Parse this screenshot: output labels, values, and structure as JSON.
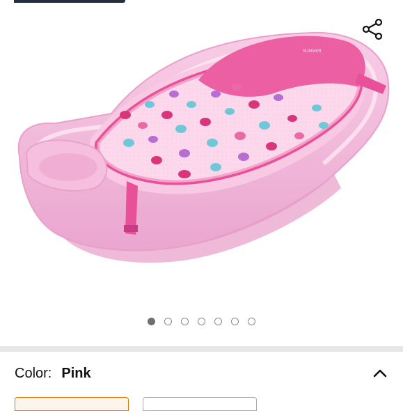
{
  "gallery": {
    "image_alt": "Pink baby bath tub with whale-print sling",
    "brand_mark": "SUMMER",
    "image_count": 7,
    "active_index": 0
  },
  "icons": {
    "share": "share-icon",
    "collapse": "chevron-up-icon"
  },
  "variation": {
    "label": "Color:",
    "selected": "Pink"
  },
  "colors": {
    "accent": "#e77600",
    "active_dot": "#6f6f6f",
    "divider": "#e7e7e7",
    "tub_pink": "#f5b8dc",
    "sling_pink": "#e8519a"
  }
}
